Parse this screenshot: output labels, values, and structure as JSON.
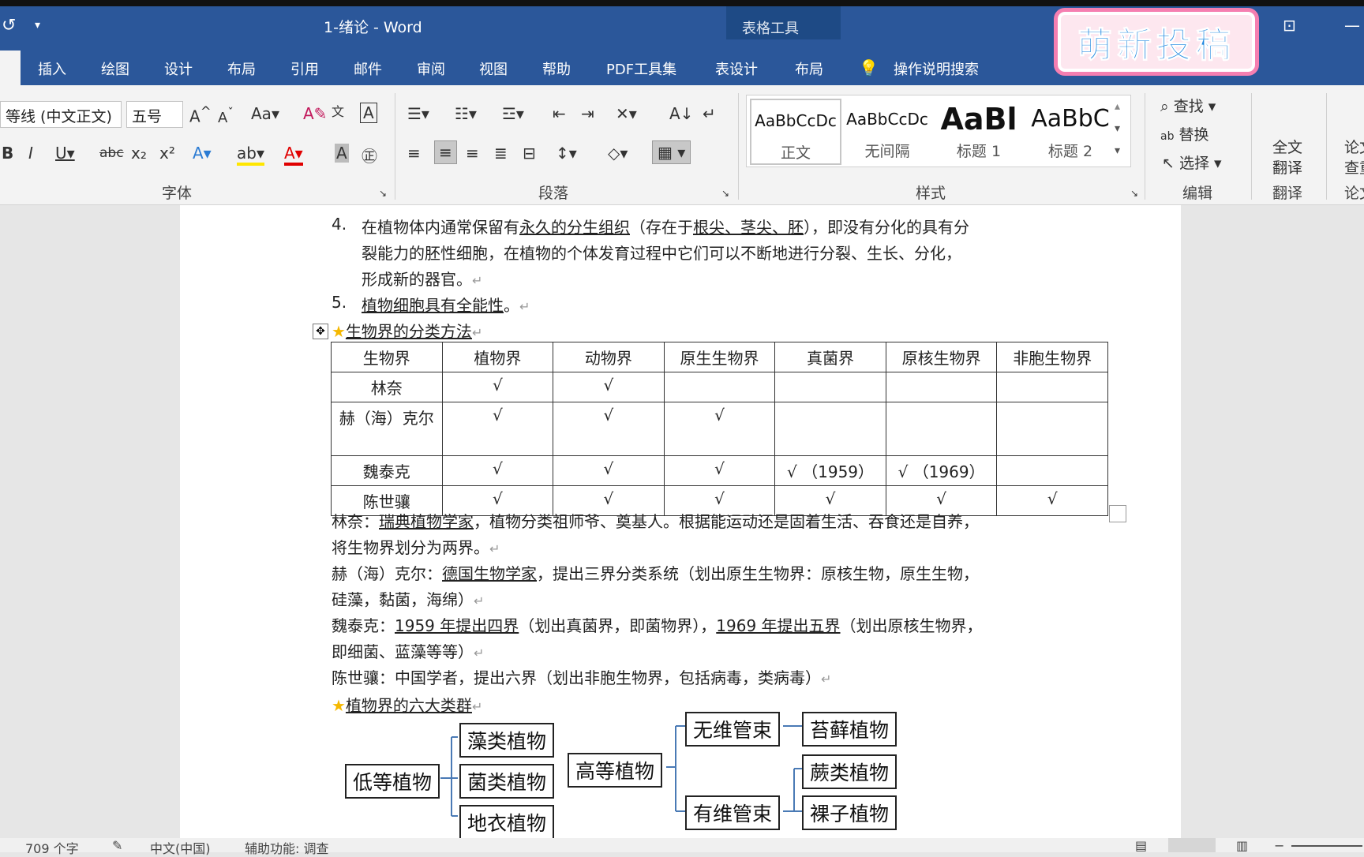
{
  "titlebar": {
    "doc_title": "1-绪论  -  Word",
    "table_tools": "表格工具"
  },
  "watermark": "萌新投稿",
  "tabs": [
    "插入",
    "绘图",
    "设计",
    "布局",
    "引用",
    "邮件",
    "审阅",
    "视图",
    "帮助",
    "PDF工具集",
    "表设计",
    "布局"
  ],
  "search_label": "操作说明搜索",
  "ribbon": {
    "font_name": "等线 (中文正文)",
    "font_size": "五号",
    "groups": {
      "font": "字体",
      "paragraph": "段落",
      "styles": "样式",
      "editing": "编辑",
      "translate": "翻译",
      "paper": "论文"
    },
    "styles": [
      {
        "preview": "AaBbCcDc",
        "name": "正文"
      },
      {
        "preview": "AaBbCcDc",
        "name": "无间隔"
      },
      {
        "preview": "AaBl",
        "name": "标题 1"
      },
      {
        "preview": "AaBbC",
        "name": "标题 2"
      }
    ],
    "find": "查找",
    "replace": "替换",
    "select": "选择",
    "full_translate_1": "全文",
    "full_translate_2": "翻译",
    "paper_1": "论文",
    "paper_2": "查重"
  },
  "doc": {
    "item4_l1a": "在植物体内通常保留有",
    "item4_l1b": "永久的分生组织",
    "item4_l1c": "（存在于",
    "item4_l1d": "根尖、茎尖、胚",
    "item4_l1e": "），即没有分化的具有分",
    "item4_l2": "裂能力的胚性细胞，在植物的个体发育过程中它们可以不断地进行分裂、生长、分化，",
    "item4_l3": "形成新的器官。",
    "item5_text": "植物细胞具有全能性",
    "heading1": "生物界的分类方法",
    "table_header": [
      "生物界",
      "植物界",
      "动物界",
      "原生生物界",
      "真菌界",
      "原核生物界",
      "非胞生物界"
    ],
    "table_rows": [
      [
        "林奈",
        "√",
        "√",
        "",
        "",
        "",
        ""
      ],
      [
        "赫（海）克尔",
        "√",
        "√",
        "√",
        "",
        "",
        ""
      ],
      [
        "魏泰克",
        "√",
        "√",
        "√",
        "√ （1959）",
        "√ （1969）",
        ""
      ],
      [
        "陈世骧",
        "√",
        "√",
        "√",
        "√",
        "√",
        "√"
      ]
    ],
    "p1_a": "林奈：",
    "p1_b": "瑞典植物学家",
    "p1_c": "，植物分类祖师爷、奠基人。根据能运动还是固着生活、吞食还是自养，",
    "p1_d": "将生物界划分为两界。",
    "p2_a": "赫（海）克尔：",
    "p2_b": "德国生物学家",
    "p2_c": "，提出三界分类系统（划出原生生物界：原核生物，原生生物，",
    "p2_d": "硅藻，黏菌，海绵）",
    "p3_a": "魏泰克：",
    "p3_b": "1959 年提出四界",
    "p3_c": "（划出真菌界，即菌物界），",
    "p3_d": "1969 年提出五界",
    "p3_e": "（划出原核生物界，",
    "p3_f": "即细菌、蓝藻等等）",
    "p4": "陈世骧：中国学者，提出六界（划出非胞生物界，包括病毒，类病毒）",
    "heading2": "植物界的六大类群",
    "diagram": {
      "low": "低等植物",
      "algae": "藻类植物",
      "fungi": "菌类植物",
      "lichen": "地衣植物",
      "high": "高等植物",
      "nonvascular": "无维管束",
      "vascular": "有维管束",
      "moss": "苔藓植物",
      "fern": "蕨类植物",
      "gymno": "裸子植物"
    }
  },
  "status": {
    "words": "709 个字",
    "lang": "中文(中国)",
    "access": "辅助功能: 调查"
  }
}
